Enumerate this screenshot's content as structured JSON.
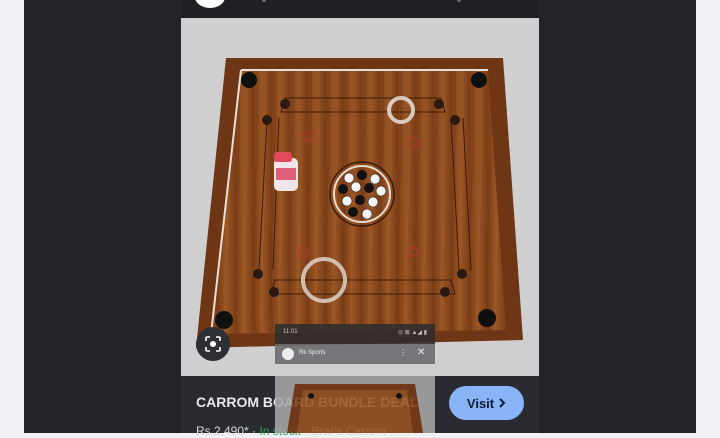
{
  "product": {
    "title": "CARROM BOARD BUNDLE DEAL",
    "price": "Rs 2,490*",
    "stock": "In stock",
    "source": "Brar's Carrom"
  },
  "visit_label": "Visit",
  "overlay": {
    "time": "11:01",
    "status_icons": "◎ ⊠ ▲◢ ▮",
    "site": "Rk Sports",
    "menu": "⋮",
    "close": "✕"
  },
  "colors": {
    "background": "#f0f1f5",
    "viewer": "#232428",
    "visit_button": "#8ab4f8",
    "board_wood": "#8b4a1f",
    "stock_green": "#2ea44f"
  },
  "icons": {
    "lens": "lens-icon",
    "visit_chevron": "chevron-right-icon"
  }
}
